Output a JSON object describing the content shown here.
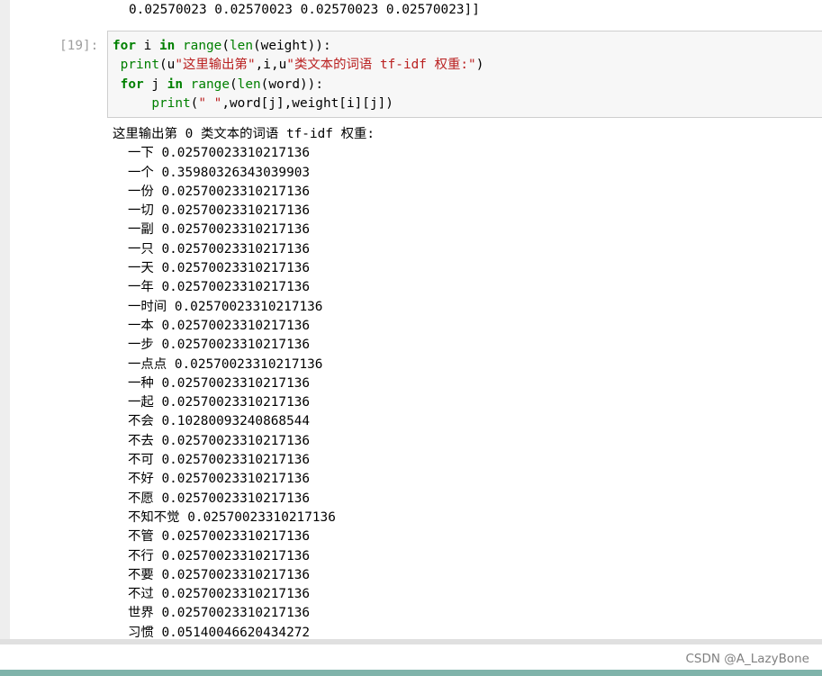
{
  "previous_output": "0.02570023 0.02570023 0.02570023 0.02570023]]",
  "cell": {
    "prompt": "[19]:",
    "code": {
      "line1": {
        "kw_for": "for",
        "var_i": " i ",
        "kw_in": "in",
        "space": " ",
        "fn_range": "range",
        "paren1": "(",
        "fn_len": "len",
        "arg": "(weight)):"
      },
      "line2": {
        "indent": " ",
        "fn_print": "print",
        "open": "(u",
        "str1": "\"这里输出第\"",
        "mid": ",i,u",
        "str2": "\"类文本的词语 tf-idf 权重:\"",
        "close": ")"
      },
      "line3": {
        "indent": " ",
        "kw_for": "for",
        "var_j": " j ",
        "kw_in": "in",
        "space": " ",
        "fn_range": "range",
        "paren1": "(",
        "fn_len": "len",
        "arg": "(word)):"
      },
      "line4": {
        "indent": "     ",
        "fn_print": "print",
        "open": "(",
        "str1": "\" \"",
        "rest": ",word[j],weight[i][j])"
      }
    }
  },
  "output": {
    "header": "这里输出第 0 类文本的词语 tf-idf 权重:",
    "rows": [
      {
        "word": "一下",
        "value": "0.02570023310217136"
      },
      {
        "word": "一个",
        "value": "0.35980326343039903"
      },
      {
        "word": "一份",
        "value": "0.02570023310217136"
      },
      {
        "word": "一切",
        "value": "0.02570023310217136"
      },
      {
        "word": "一副",
        "value": "0.02570023310217136"
      },
      {
        "word": "一只",
        "value": "0.02570023310217136"
      },
      {
        "word": "一天",
        "value": "0.02570023310217136"
      },
      {
        "word": "一年",
        "value": "0.02570023310217136"
      },
      {
        "word": "一时间",
        "value": "0.02570023310217136"
      },
      {
        "word": "一本",
        "value": "0.02570023310217136"
      },
      {
        "word": "一步",
        "value": "0.02570023310217136"
      },
      {
        "word": "一点点",
        "value": "0.02570023310217136"
      },
      {
        "word": "一种",
        "value": "0.02570023310217136"
      },
      {
        "word": "一起",
        "value": "0.02570023310217136"
      },
      {
        "word": "不会",
        "value": "0.10280093240868544"
      },
      {
        "word": "不去",
        "value": "0.02570023310217136"
      },
      {
        "word": "不可",
        "value": "0.02570023310217136"
      },
      {
        "word": "不好",
        "value": "0.02570023310217136"
      },
      {
        "word": "不愿",
        "value": "0.02570023310217136"
      },
      {
        "word": "不知不觉",
        "value": "0.02570023310217136"
      },
      {
        "word": "不管",
        "value": "0.02570023310217136"
      },
      {
        "word": "不行",
        "value": "0.02570023310217136"
      },
      {
        "word": "不要",
        "value": "0.02570023310217136"
      },
      {
        "word": "不过",
        "value": "0.02570023310217136"
      },
      {
        "word": "世界",
        "value": "0.02570023310217136"
      },
      {
        "word": "习惯",
        "value": "0.05140046620434272"
      }
    ]
  },
  "watermark": "CSDN @A_LazyBone"
}
